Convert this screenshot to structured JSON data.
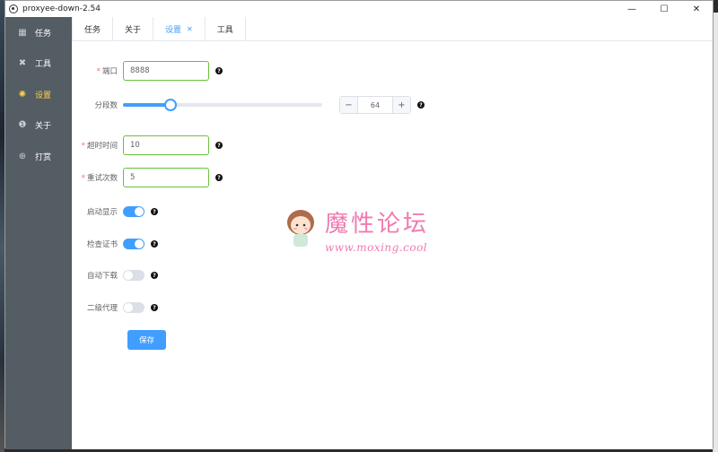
{
  "window": {
    "title": "proxyee-down-2.54",
    "minimize_glyph": "—",
    "maximize_glyph": "☐",
    "close_glyph": "✕"
  },
  "sidebar": {
    "items": [
      {
        "label": "任务",
        "icon": "grid-icon",
        "glyph": "▦",
        "active": false
      },
      {
        "label": "工具",
        "icon": "wrench-icon",
        "glyph": "✖",
        "active": false
      },
      {
        "label": "设置",
        "icon": "gear-icon",
        "glyph": "✺",
        "active": true
      },
      {
        "label": "关于",
        "icon": "info-icon",
        "glyph": "❶",
        "active": false
      },
      {
        "label": "打赏",
        "icon": "plus-circle-icon",
        "glyph": "⊕",
        "active": false
      }
    ]
  },
  "tabs": [
    {
      "label": "任务",
      "active": false
    },
    {
      "label": "关于",
      "active": false
    },
    {
      "label": "设置",
      "active": true,
      "closable": true,
      "close_glyph": "✕"
    },
    {
      "label": "工具",
      "active": false
    }
  ],
  "form": {
    "help_glyph": "?",
    "port": {
      "label": "端口",
      "required_mark": "*",
      "value": "8888"
    },
    "segments": {
      "label": "分段数",
      "value": "64",
      "minus": "−",
      "plus": "+",
      "slider_fraction": 0.24
    },
    "timeout": {
      "label": "超时时间",
      "required_mark": "*",
      "value": "10"
    },
    "retry": {
      "label": "重试次数",
      "required_mark": "*",
      "value": "5"
    },
    "auto_show": {
      "label": "启动显示",
      "on": true
    },
    "check_cert": {
      "label": "检查证书",
      "on": true
    },
    "auto_download": {
      "label": "自动下载",
      "on": false
    },
    "second_proxy": {
      "label": "二级代理",
      "on": false
    },
    "save_label": "保存"
  },
  "watermark": {
    "title": "魔性论坛",
    "url": "www.moxing.cool"
  },
  "colors": {
    "accent": "#409eff",
    "sidebar_bg": "#545c64",
    "active_menu": "#ffd04b",
    "valid_border": "#67c23a",
    "required": "#f56c6c",
    "watermark": "#f07ab0"
  }
}
